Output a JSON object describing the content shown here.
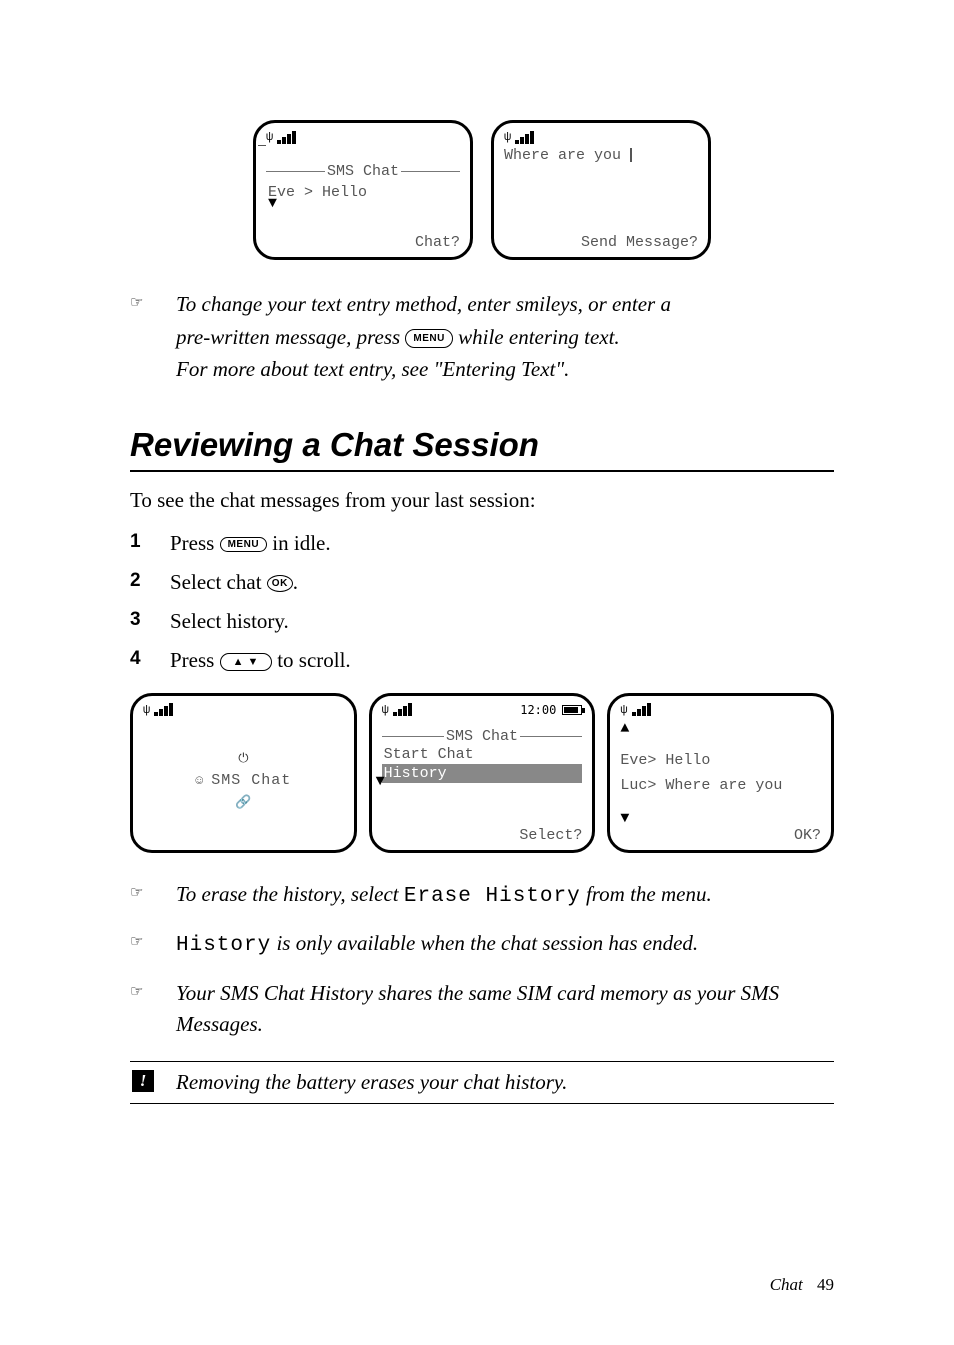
{
  "top_screens": {
    "left": {
      "title": "SMS Chat",
      "line": "Eve > Hello",
      "softkey": "Chat?"
    },
    "right": {
      "text": "Where are you",
      "softkey": "Send Message?"
    }
  },
  "tip1": {
    "line1": "To change your text entry method, enter smileys, or enter a",
    "line2_a": "pre-written message, press ",
    "key": "MENU",
    "line2_b": " while entering text.",
    "line3": "For more about text entry, see \"Entering Text\"."
  },
  "section_title": "Reviewing a Chat Session",
  "intro": "To see the chat messages from your last session:",
  "steps": {
    "s1_a": "Press ",
    "s1_key": "MENU",
    "s1_b": " in idle.",
    "s2_a": "Select chat ",
    "s2_key": "OK",
    "s2_b": ".",
    "s3": "Select history.",
    "s4_a": "Press ",
    "s4_key": "▲  ▼",
    "s4_b": " to scroll."
  },
  "mid_screens": {
    "a": {
      "center_icon": "⏻",
      "menu_label": "SMS Chat",
      "bottom_icon": "🔗"
    },
    "b": {
      "time": "12:00",
      "title": "SMS Chat",
      "item1": "Start Chat",
      "item2": "History",
      "softkey": "Select?"
    },
    "c": {
      "line1": "Eve> Hello",
      "line2": "Luc> Where are you",
      "softkey": "OK?"
    }
  },
  "tip2_a": "To erase the history, select ",
  "tip2_key": "Erase History",
  "tip2_b": " from the menu.",
  "tip3_a": "",
  "tip3_key": "History",
  "tip3_b": " is only available when the chat session has ended.",
  "tip4": "Your SMS Chat History shares the same SIM card memory as your SMS Messages.",
  "alert": "Removing the battery erases your chat history.",
  "footer_label": "Chat",
  "footer_page": "49"
}
